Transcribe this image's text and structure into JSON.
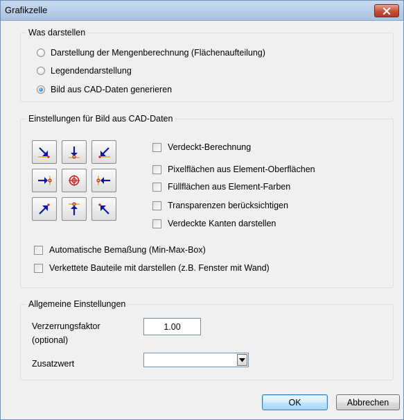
{
  "window": {
    "title": "Grafikzelle"
  },
  "section_show": {
    "legend": "Was darstellen",
    "options": [
      {
        "label": "Darstellung der Mengenberechnung (Flächenaufteilung)",
        "checked": false
      },
      {
        "label": "Legendendarstellung",
        "checked": false
      },
      {
        "label": "Bild aus CAD-Daten generieren",
        "checked": true
      }
    ]
  },
  "section_cad": {
    "legend": "Einstellungen für Bild aus CAD-Daten",
    "direction_buttons": [
      "view-top-left-icon",
      "view-top-icon",
      "view-top-right-icon",
      "view-left-icon",
      "view-center-icon",
      "view-right-icon",
      "view-bottom-left-icon",
      "view-bottom-icon",
      "view-bottom-right-icon"
    ],
    "checkboxes": {
      "hidden_calc": "Verdeckt-Berechnung",
      "pixel_surfaces": "Pixelflächen aus Element-Oberflächen",
      "fill_surfaces": "Füllflächen aus Element-Farben",
      "transparency": "Transparenzen berücksichtigen",
      "hidden_edges": "Verdeckte Kanten darstellen",
      "auto_dimension": "Automatische Bemaßung (Min-Max-Box)",
      "linked_parts": "Verkettete Bauteile mit darstellen (z.B. Fenster mit Wand)"
    }
  },
  "section_general": {
    "legend": "Allgemeine Einstellungen",
    "distortion_label_line1": "Verzerrungsfaktor",
    "distortion_label_line2": "(optional)",
    "distortion_value": "1.00",
    "extra_label": "Zusatzwert",
    "extra_value": ""
  },
  "buttons": {
    "ok": "OK",
    "cancel": "Abbrechen"
  },
  "colors": {
    "titlebar": "#b9cfe9",
    "close_button": "#c75038",
    "group_border": "#d5dfe5",
    "dialog_bg": "#f0f0f0"
  }
}
